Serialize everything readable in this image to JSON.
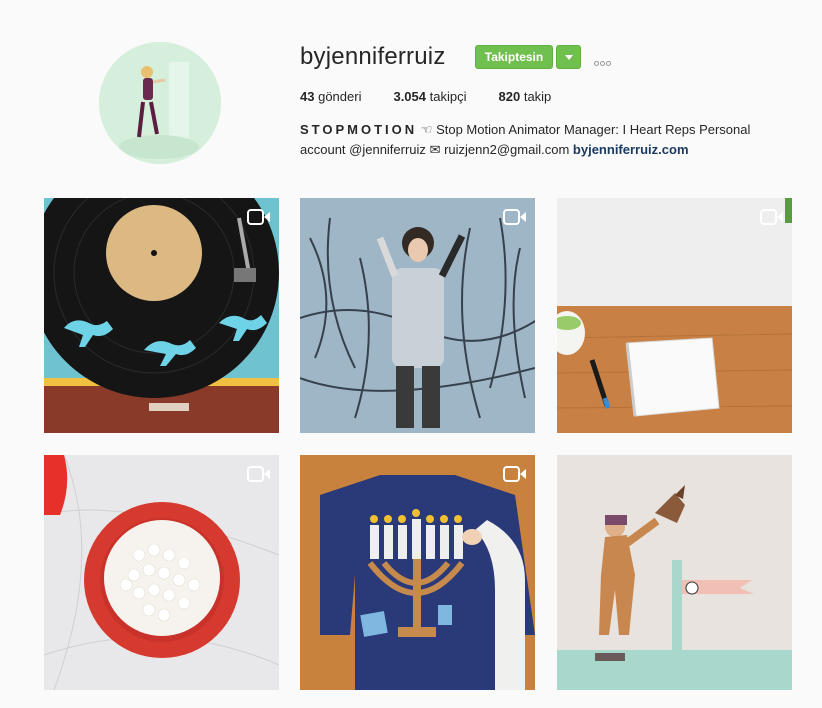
{
  "profile": {
    "username": "byjenniferruiz",
    "follow_label": "Takiptesin",
    "stats": {
      "posts_count": "43",
      "posts_label": "gönderi",
      "followers_count": "3.054",
      "followers_label": "takipçi",
      "following_count": "820",
      "following_label": "takip"
    },
    "bio": {
      "name": "STOPMOTION",
      "line1": "Stop Motion Animator Manager: I Heart Reps Personal",
      "line2": "account @jenniferruiz",
      "email": "ruizjenn2@gmail.com",
      "link": "byjenniferruiz.com"
    }
  },
  "icons": {
    "more": "more-icon",
    "dropdown": "chevron-down-icon",
    "video": "video-camera-icon",
    "hand": "pointing-hand-icon",
    "mail": "envelope-icon"
  },
  "colors": {
    "follow_green": "#70c050",
    "link_blue": "#1a3a60"
  },
  "posts": [
    {
      "id": "record-player",
      "is_video": true
    },
    {
      "id": "paint-splatter-person",
      "is_video": true
    },
    {
      "id": "notebook-marker-desk",
      "is_video": true
    },
    {
      "id": "marshmallows-bowl",
      "is_video": true
    },
    {
      "id": "menorah-sweater",
      "is_video": true
    },
    {
      "id": "paper-falcon-figure",
      "is_video": false
    }
  ]
}
